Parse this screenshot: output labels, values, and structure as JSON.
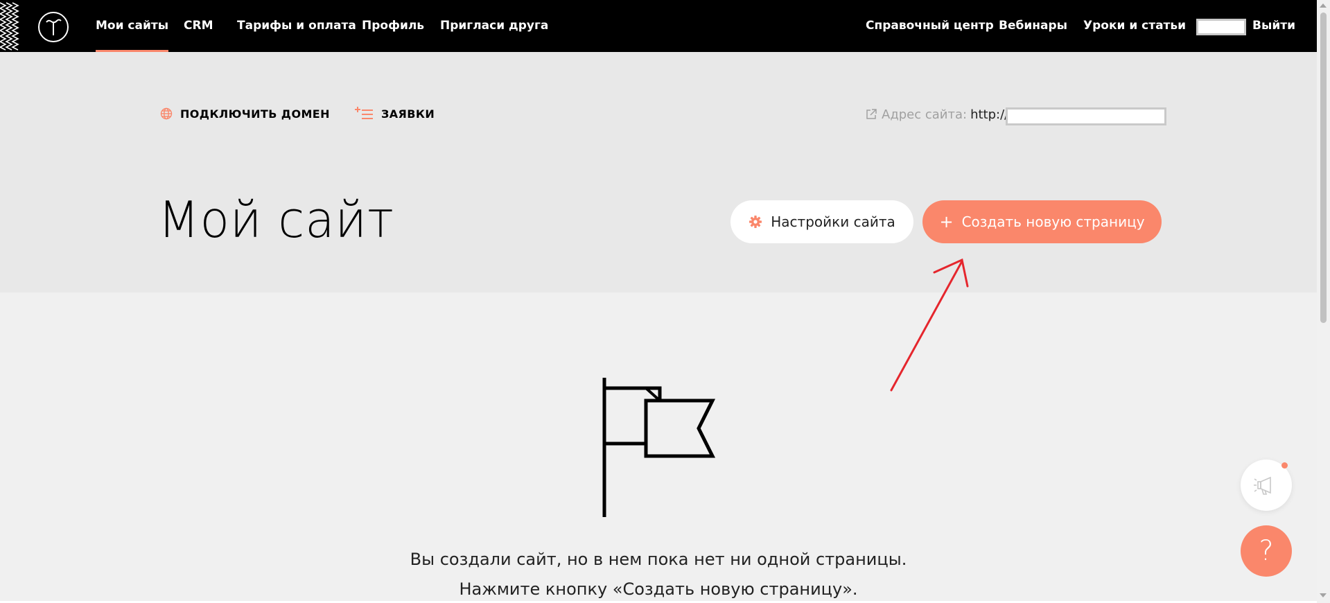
{
  "nav": {
    "left": [
      {
        "label": "Мои сайты",
        "active": true
      },
      {
        "label": "CRM"
      },
      {
        "label": "Тарифы и оплата"
      },
      {
        "label": "Профиль"
      },
      {
        "label": "Пригласи друга"
      }
    ],
    "right": [
      {
        "label": "Справочный центр"
      },
      {
        "label": "Вебинары"
      },
      {
        "label": "Уроки и статьи"
      }
    ],
    "logout_label": "Выйти"
  },
  "toolbar": {
    "connect_domain_label": "ПОДКЛЮЧИТЬ ДОМЕН",
    "requests_label": "ЗАЯВКИ",
    "site_address_label": "Адрес сайта:",
    "site_address_prefix": "http://"
  },
  "page": {
    "title": "Мой сайт",
    "settings_button_label": "Настройки сайта",
    "create_button_label": "Создать новую страницу",
    "create_button_plus": "+"
  },
  "empty_state": {
    "line1": "Вы создали сайт, но в нем пока нет ни одной страницы.",
    "line2": "Нажмите кнопку «Создать новую страницу»."
  },
  "help_fab_symbol": "?",
  "colors": {
    "accent": "#fa876b",
    "topbar": "#000000",
    "header_band": "#e8e8e8",
    "background": "#f0f0f0",
    "annotation_arrow": "#e5262d"
  }
}
